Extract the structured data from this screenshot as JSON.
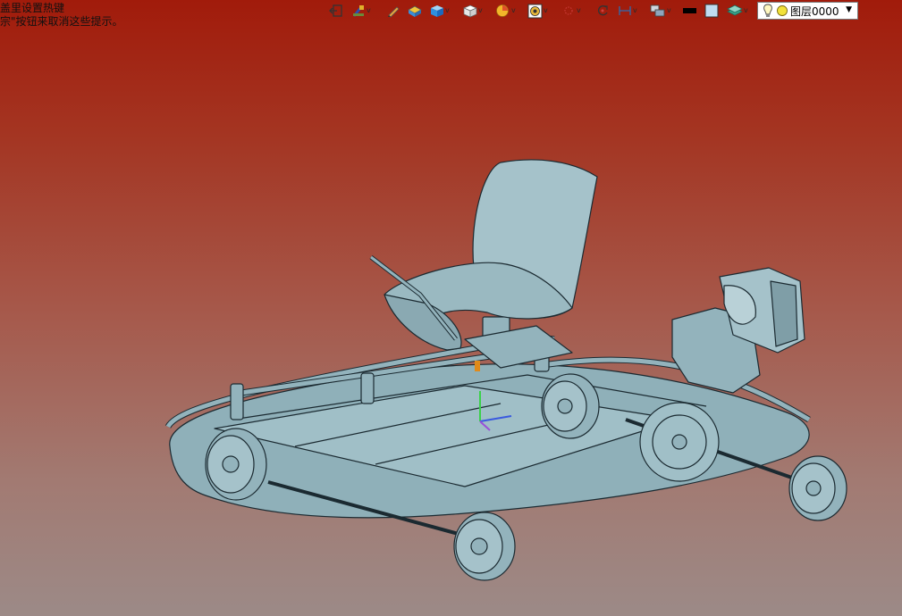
{
  "hint": {
    "line1": "盖里设置热键",
    "line2": "宗\"按钮来取消这些提示。"
  },
  "toolbar": {
    "items": [
      {
        "name": "exit-icon",
        "has_menu": false
      },
      {
        "name": "pipette-icon",
        "has_menu": true
      },
      {
        "name": "pencil-icon",
        "has_menu": false
      },
      {
        "name": "material-icon",
        "has_menu": false
      },
      {
        "name": "cube-blue-icon",
        "has_menu": true
      },
      {
        "name": "cube-white-icon",
        "has_menu": true
      },
      {
        "name": "section-icon",
        "has_menu": true
      },
      {
        "name": "render-icon",
        "has_menu": true
      },
      {
        "name": "snap-icon",
        "has_menu": true
      },
      {
        "name": "rotate-icon",
        "has_menu": false
      },
      {
        "name": "measure-icon",
        "has_menu": true
      },
      {
        "name": "layers-display-icon",
        "has_menu": true
      },
      {
        "name": "line-color-icon",
        "has_menu": false
      },
      {
        "name": "fill-color-icon",
        "has_menu": false
      },
      {
        "name": "layer-stack-icon",
        "has_menu": true
      }
    ],
    "chevron": "v"
  },
  "layer_dropdown": {
    "value": "图层0000",
    "arrow": "▼",
    "bulb_icon": "lightbulb-icon",
    "state_icon": "yellow-circle-icon",
    "state_color": "#f2e23a"
  },
  "model": {
    "body_color": "#93b3bc",
    "edge_color": "#1b2a31"
  }
}
